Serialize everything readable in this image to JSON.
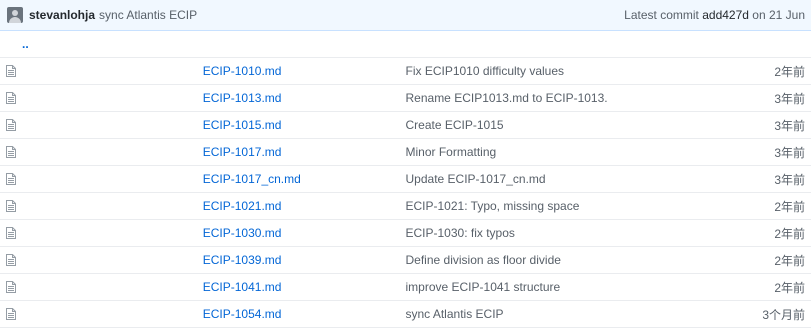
{
  "commit": {
    "author": "stevanlohja",
    "message": "sync Atlantis ECIP",
    "latest_label": "Latest commit",
    "sha": "add427d",
    "date": "on 21 Jun"
  },
  "parent_link": "..",
  "files": [
    {
      "name": "ECIP-1010.md",
      "message": "Fix ECIP1010 difficulty values",
      "age": "2年前"
    },
    {
      "name": "ECIP-1013.md",
      "message": "Rename ECIP1013.md to ECIP-1013.md",
      "age": "3年前"
    },
    {
      "name": "ECIP-1015.md",
      "message": "Create ECIP-1015",
      "age": "3年前"
    },
    {
      "name": "ECIP-1017.md",
      "message": "Minor Formatting",
      "age": "3年前"
    },
    {
      "name": "ECIP-1017_cn.md",
      "message": "Update ECIP-1017_cn.md",
      "age": "3年前"
    },
    {
      "name": "ECIP-1021.md",
      "message": "ECIP-1021: Typo, missing space",
      "age": "2年前"
    },
    {
      "name": "ECIP-1030.md",
      "message": "ECIP-1030: fix typos",
      "age": "2年前"
    },
    {
      "name": "ECIP-1039.md",
      "message": "Define division as floor divide",
      "age": "2年前"
    },
    {
      "name": "ECIP-1041.md",
      "message": "improve ECIP-1041 structure",
      "age": "2年前"
    },
    {
      "name": "ECIP-1054.md",
      "message": "sync Atlantis ECIP",
      "age": "3个月前"
    }
  ],
  "colors": {
    "link": "#0366d6",
    "commit_bar_bg": "#f1f8ff",
    "muted": "#586069"
  },
  "icons": {
    "file": "file-text-icon",
    "avatar": "user-avatar"
  }
}
